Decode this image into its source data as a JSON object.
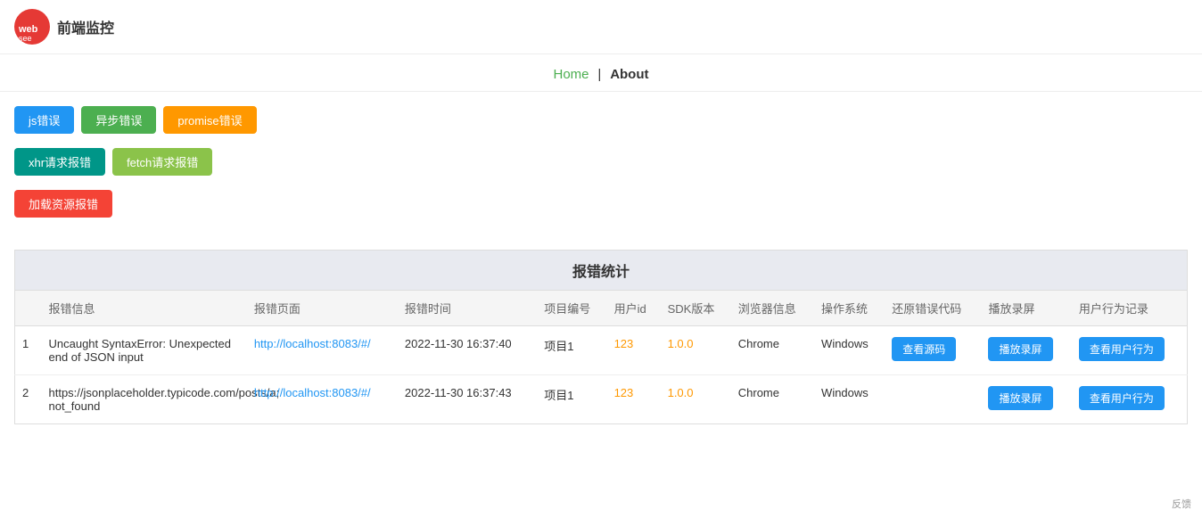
{
  "header": {
    "logo_text": "前端监控",
    "logo_brand": "websee"
  },
  "nav": {
    "home_label": "Home",
    "separator": "|",
    "about_label": "About"
  },
  "buttons": {
    "row1": [
      {
        "label": "js错误",
        "color": "btn-blue"
      },
      {
        "label": "异步错误",
        "color": "btn-green"
      },
      {
        "label": "promise错误",
        "color": "btn-orange"
      }
    ],
    "row2": [
      {
        "label": "xhr请求报错",
        "color": "btn-teal"
      },
      {
        "label": "fetch请求报错",
        "color": "btn-yellow-green"
      }
    ],
    "row3": [
      {
        "label": "加载资源报错",
        "color": "btn-red"
      }
    ]
  },
  "table": {
    "title": "报错统计",
    "columns": [
      "报错信息",
      "报错页面",
      "报错时间",
      "项目编号",
      "用户id",
      "SDK版本",
      "浏览器信息",
      "操作系统",
      "还原错误代码",
      "播放录屏",
      "用户行为记录"
    ],
    "rows": [
      {
        "index": "1",
        "error_msg": "Uncaught SyntaxError: Unexpected end of JSON input",
        "page": "http://localhost:8083/#/",
        "time": "2022-11-30 16:37:40",
        "project": "项目1",
        "user_id": "123",
        "sdk": "1.0.0",
        "browser": "Chrome",
        "os": "Windows",
        "has_source": true,
        "source_btn": "查看源码",
        "replay_btn": "播放录屏",
        "behavior_btn": "查看用户行为"
      },
      {
        "index": "2",
        "error_msg": "https://jsonplaceholder.typicode.com/posts/a; not_found",
        "page": "http://localhost:8083/#/",
        "time": "2022-11-30 16:37:43",
        "project": "项目1",
        "user_id": "123",
        "sdk": "1.0.0",
        "browser": "Chrome",
        "os": "Windows",
        "has_source": false,
        "source_btn": "",
        "replay_btn": "播放录屏",
        "behavior_btn": "查看用户行为"
      }
    ]
  },
  "footer": {
    "hint": "反馈"
  }
}
